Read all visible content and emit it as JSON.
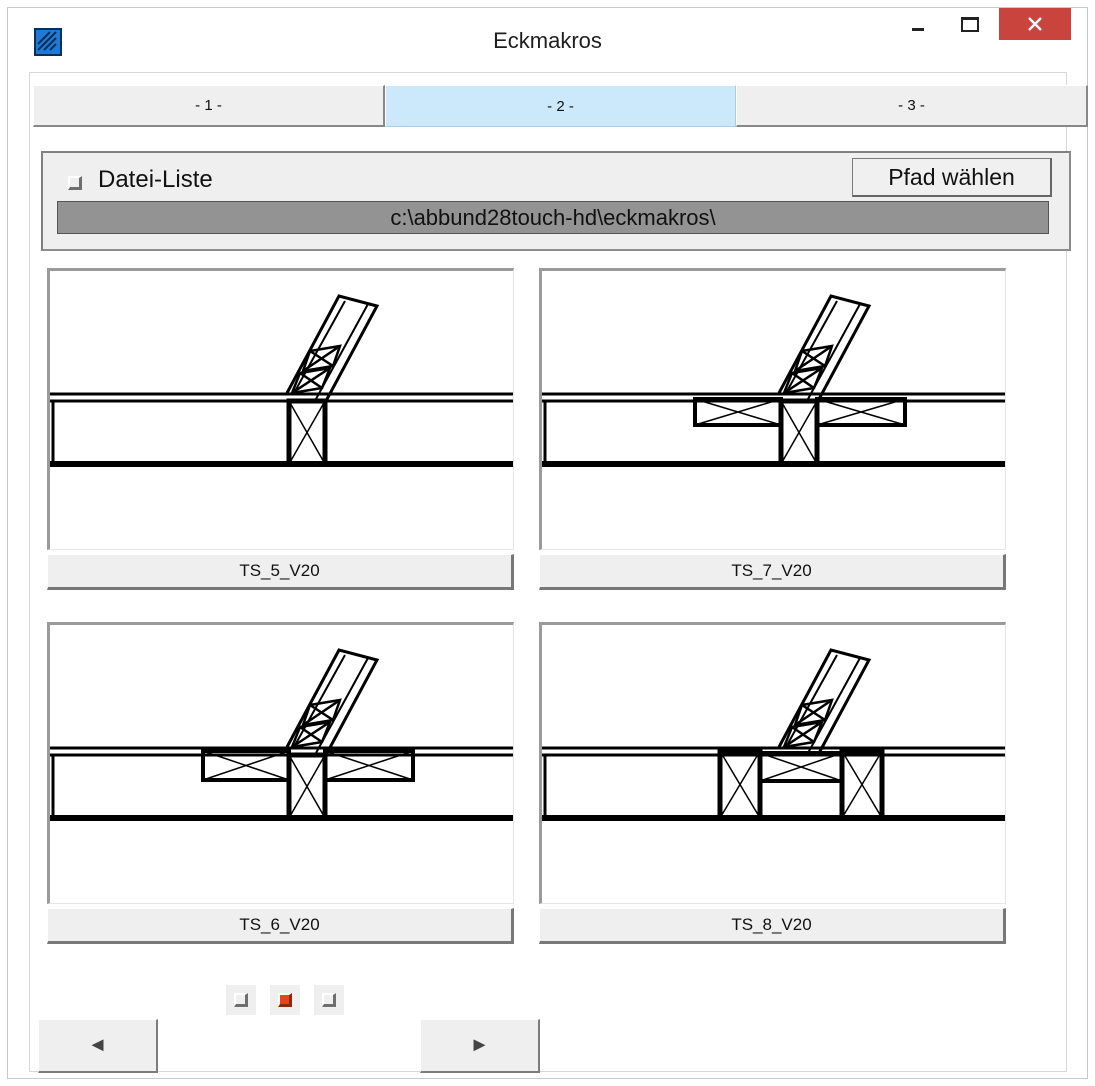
{
  "window": {
    "title": "Eckmakros",
    "close_glyph": "×"
  },
  "tabs": [
    {
      "label": "- 1 -"
    },
    {
      "label": "- 2 -"
    },
    {
      "label": "- 3 -"
    }
  ],
  "active_tab": 1,
  "path_panel": {
    "file_list_label": "Datei-Liste",
    "file_list_checked": false,
    "choose_path_label": "Pfad wählen",
    "path": "c:\\abbund28touch-hd\\eckmakros\\"
  },
  "macros": [
    {
      "name": "TS_5_V20",
      "variant": "plain"
    },
    {
      "name": "TS_7_V20",
      "variant": "cross-both-low"
    },
    {
      "name": "TS_6_V20",
      "variant": "cross-both-high"
    },
    {
      "name": "TS_8_V20",
      "variant": "double-post"
    }
  ],
  "pager": {
    "pages": 3,
    "current": 2,
    "prev_glyph": "◄",
    "next_glyph": "►"
  },
  "colors": {
    "active_tab": "#cce8fb",
    "close_button": "#c9443c",
    "active_page": "#e8441b",
    "path_field": "#939393"
  },
  "icons": [
    "app-icon",
    "minimize-icon",
    "maximize-icon",
    "close-icon",
    "arrow-left-icon",
    "arrow-right-icon"
  ]
}
